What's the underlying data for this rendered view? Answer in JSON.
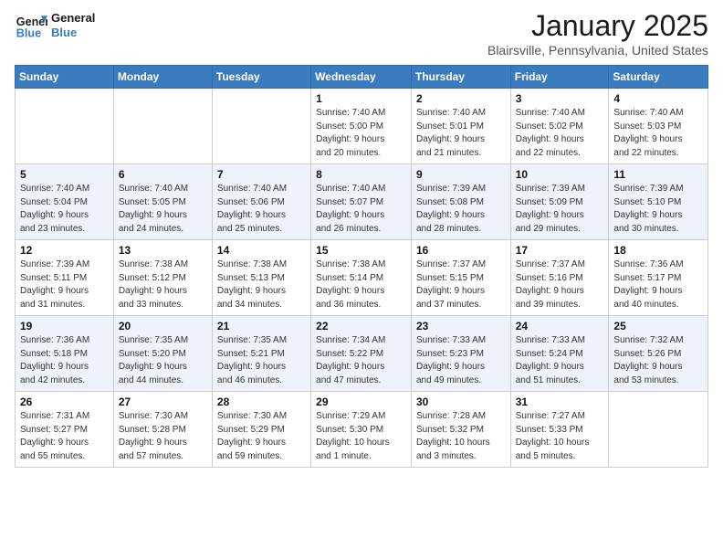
{
  "logo": {
    "line1": "General",
    "line2": "Blue"
  },
  "header": {
    "month": "January 2025",
    "location": "Blairsville, Pennsylvania, United States"
  },
  "weekdays": [
    "Sunday",
    "Monday",
    "Tuesday",
    "Wednesday",
    "Thursday",
    "Friday",
    "Saturday"
  ],
  "weeks": [
    [
      {
        "day": "",
        "info": ""
      },
      {
        "day": "",
        "info": ""
      },
      {
        "day": "",
        "info": ""
      },
      {
        "day": "1",
        "info": "Sunrise: 7:40 AM\nSunset: 5:00 PM\nDaylight: 9 hours\nand 20 minutes."
      },
      {
        "day": "2",
        "info": "Sunrise: 7:40 AM\nSunset: 5:01 PM\nDaylight: 9 hours\nand 21 minutes."
      },
      {
        "day": "3",
        "info": "Sunrise: 7:40 AM\nSunset: 5:02 PM\nDaylight: 9 hours\nand 22 minutes."
      },
      {
        "day": "4",
        "info": "Sunrise: 7:40 AM\nSunset: 5:03 PM\nDaylight: 9 hours\nand 22 minutes."
      }
    ],
    [
      {
        "day": "5",
        "info": "Sunrise: 7:40 AM\nSunset: 5:04 PM\nDaylight: 9 hours\nand 23 minutes."
      },
      {
        "day": "6",
        "info": "Sunrise: 7:40 AM\nSunset: 5:05 PM\nDaylight: 9 hours\nand 24 minutes."
      },
      {
        "day": "7",
        "info": "Sunrise: 7:40 AM\nSunset: 5:06 PM\nDaylight: 9 hours\nand 25 minutes."
      },
      {
        "day": "8",
        "info": "Sunrise: 7:40 AM\nSunset: 5:07 PM\nDaylight: 9 hours\nand 26 minutes."
      },
      {
        "day": "9",
        "info": "Sunrise: 7:39 AM\nSunset: 5:08 PM\nDaylight: 9 hours\nand 28 minutes."
      },
      {
        "day": "10",
        "info": "Sunrise: 7:39 AM\nSunset: 5:09 PM\nDaylight: 9 hours\nand 29 minutes."
      },
      {
        "day": "11",
        "info": "Sunrise: 7:39 AM\nSunset: 5:10 PM\nDaylight: 9 hours\nand 30 minutes."
      }
    ],
    [
      {
        "day": "12",
        "info": "Sunrise: 7:39 AM\nSunset: 5:11 PM\nDaylight: 9 hours\nand 31 minutes."
      },
      {
        "day": "13",
        "info": "Sunrise: 7:38 AM\nSunset: 5:12 PM\nDaylight: 9 hours\nand 33 minutes."
      },
      {
        "day": "14",
        "info": "Sunrise: 7:38 AM\nSunset: 5:13 PM\nDaylight: 9 hours\nand 34 minutes."
      },
      {
        "day": "15",
        "info": "Sunrise: 7:38 AM\nSunset: 5:14 PM\nDaylight: 9 hours\nand 36 minutes."
      },
      {
        "day": "16",
        "info": "Sunrise: 7:37 AM\nSunset: 5:15 PM\nDaylight: 9 hours\nand 37 minutes."
      },
      {
        "day": "17",
        "info": "Sunrise: 7:37 AM\nSunset: 5:16 PM\nDaylight: 9 hours\nand 39 minutes."
      },
      {
        "day": "18",
        "info": "Sunrise: 7:36 AM\nSunset: 5:17 PM\nDaylight: 9 hours\nand 40 minutes."
      }
    ],
    [
      {
        "day": "19",
        "info": "Sunrise: 7:36 AM\nSunset: 5:18 PM\nDaylight: 9 hours\nand 42 minutes."
      },
      {
        "day": "20",
        "info": "Sunrise: 7:35 AM\nSunset: 5:20 PM\nDaylight: 9 hours\nand 44 minutes."
      },
      {
        "day": "21",
        "info": "Sunrise: 7:35 AM\nSunset: 5:21 PM\nDaylight: 9 hours\nand 46 minutes."
      },
      {
        "day": "22",
        "info": "Sunrise: 7:34 AM\nSunset: 5:22 PM\nDaylight: 9 hours\nand 47 minutes."
      },
      {
        "day": "23",
        "info": "Sunrise: 7:33 AM\nSunset: 5:23 PM\nDaylight: 9 hours\nand 49 minutes."
      },
      {
        "day": "24",
        "info": "Sunrise: 7:33 AM\nSunset: 5:24 PM\nDaylight: 9 hours\nand 51 minutes."
      },
      {
        "day": "25",
        "info": "Sunrise: 7:32 AM\nSunset: 5:26 PM\nDaylight: 9 hours\nand 53 minutes."
      }
    ],
    [
      {
        "day": "26",
        "info": "Sunrise: 7:31 AM\nSunset: 5:27 PM\nDaylight: 9 hours\nand 55 minutes."
      },
      {
        "day": "27",
        "info": "Sunrise: 7:30 AM\nSunset: 5:28 PM\nDaylight: 9 hours\nand 57 minutes."
      },
      {
        "day": "28",
        "info": "Sunrise: 7:30 AM\nSunset: 5:29 PM\nDaylight: 9 hours\nand 59 minutes."
      },
      {
        "day": "29",
        "info": "Sunrise: 7:29 AM\nSunset: 5:30 PM\nDaylight: 10 hours\nand 1 minute."
      },
      {
        "day": "30",
        "info": "Sunrise: 7:28 AM\nSunset: 5:32 PM\nDaylight: 10 hours\nand 3 minutes."
      },
      {
        "day": "31",
        "info": "Sunrise: 7:27 AM\nSunset: 5:33 PM\nDaylight: 10 hours\nand 5 minutes."
      },
      {
        "day": "",
        "info": ""
      }
    ]
  ]
}
